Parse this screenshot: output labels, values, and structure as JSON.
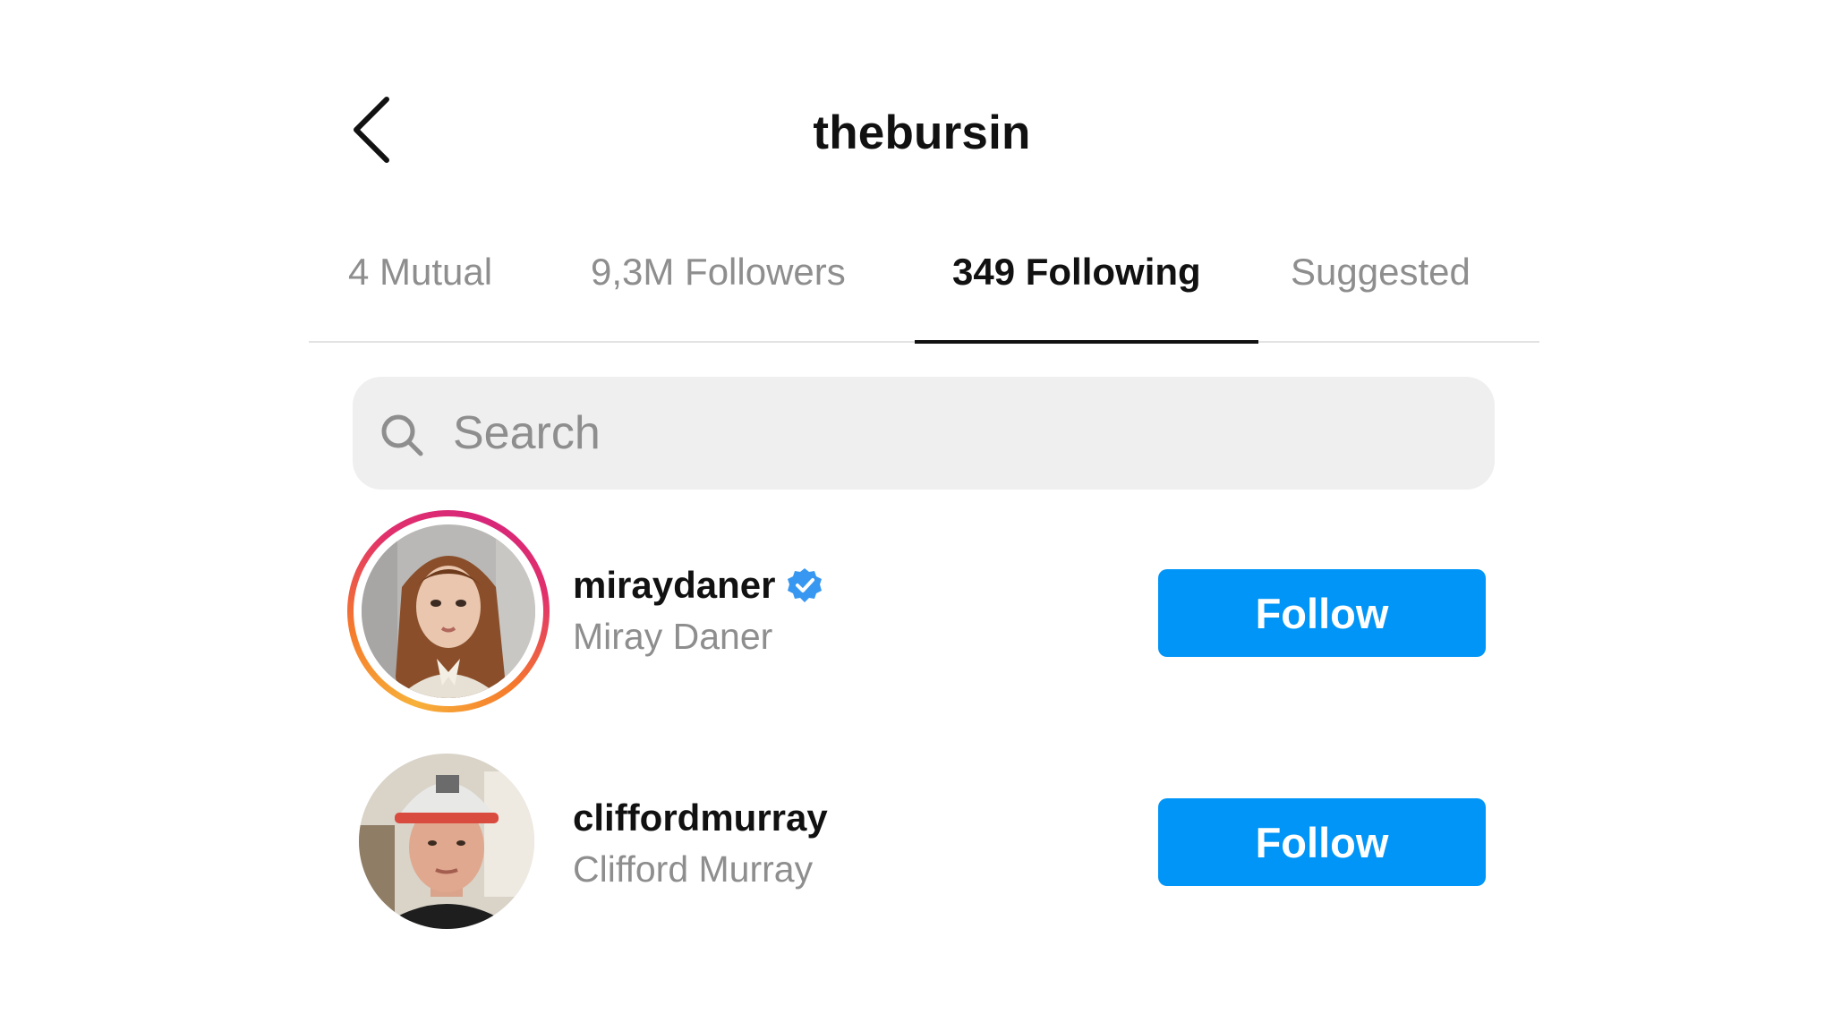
{
  "header": {
    "title": "thebursin",
    "back_icon": "chevron-left-icon"
  },
  "tabs": [
    {
      "label": "4 Mutual",
      "active": false
    },
    {
      "label": "9,3M Followers",
      "active": false
    },
    {
      "label": "349 Following",
      "active": true
    },
    {
      "label": "Suggested",
      "active": false
    }
  ],
  "search": {
    "placeholder": "Search",
    "value": "",
    "icon": "search-icon"
  },
  "accounts": [
    {
      "username": "miraydaner",
      "full_name": "Miray Daner",
      "verified": true,
      "has_story": true,
      "follow_label": "Follow"
    },
    {
      "username": "cliffordmurray",
      "full_name": "Clifford Murray",
      "verified": false,
      "has_story": false,
      "follow_label": "Follow"
    }
  ],
  "colors": {
    "accent": "#0095f6",
    "verified": "#3897f0",
    "muted_text": "#8e8e8e",
    "search_bg": "#efefef"
  }
}
